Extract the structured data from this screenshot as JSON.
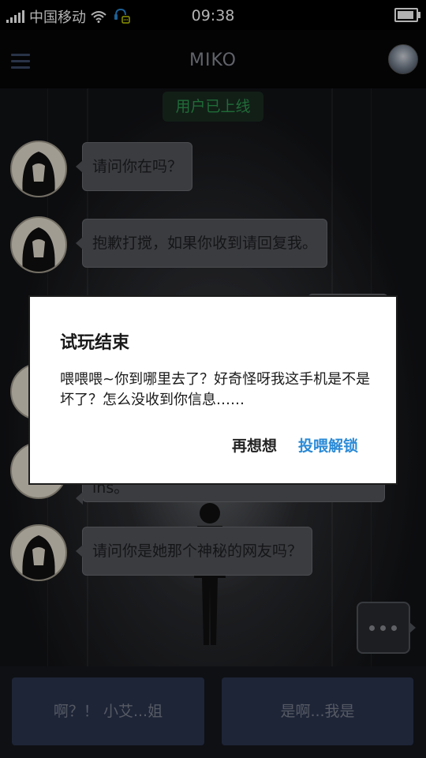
{
  "status_bar": {
    "carrier": "中国移动",
    "time": "09:38",
    "signal_icon": "signal-icon",
    "wifi_icon": "wifi-icon",
    "app_icon": "chat-notification-icon",
    "battery_icon": "battery-icon"
  },
  "header": {
    "title": "MIKO",
    "menu_icon": "menu-icon",
    "avatar": "profile-avatar"
  },
  "chat": {
    "online_status": "用户已上线",
    "messages": [
      {
        "text": "请问你在吗？"
      },
      {
        "text": "抱歉打搅，如果你收到请回复我。"
      },
      {
        "text": "请问你是她那个神秘的网友吗？"
      }
    ],
    "partial_message": "ins。",
    "more_icon": "more-dots-icon"
  },
  "replies": [
    {
      "label": "啊？！ 小艾...姐"
    },
    {
      "label": "是啊...我是"
    }
  ],
  "dialog": {
    "title": "试玩结束",
    "body": "喂喂喂~你到哪里去了？好奇怪呀我这手机是不是坏了？怎么没收到你信息……",
    "cancel_label": "再想想",
    "confirm_label": "投喂解锁"
  },
  "colors": {
    "accent": "#2a8ad6",
    "online_green": "#2e9a50",
    "reply_bg": "#2b3550"
  }
}
